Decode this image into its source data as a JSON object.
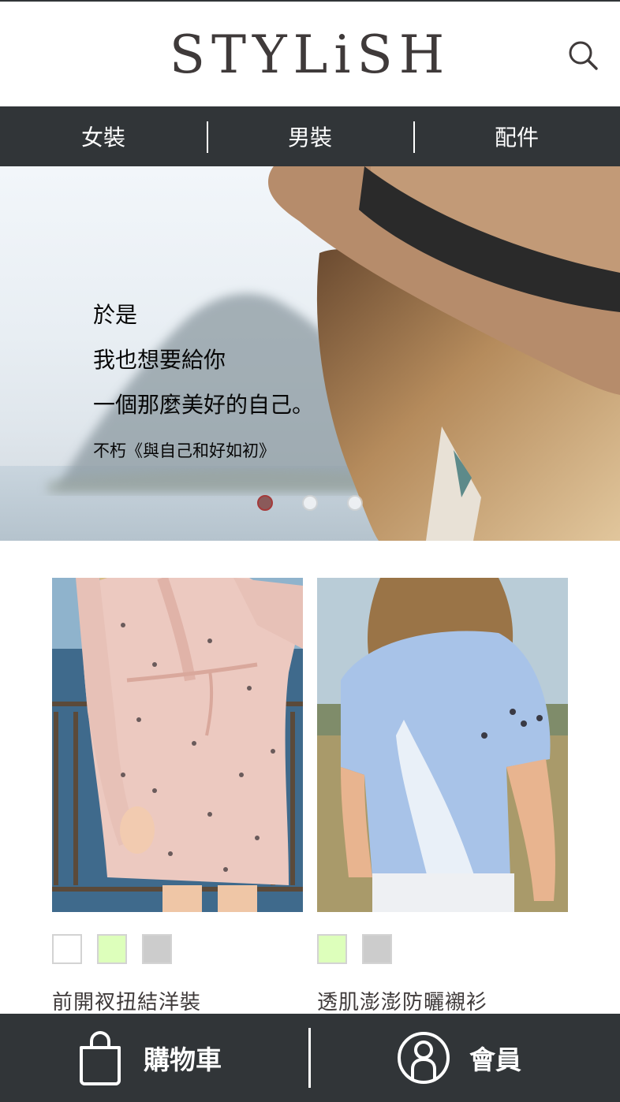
{
  "header": {
    "logo_text": "STYLiSH",
    "search_icon": "search-icon"
  },
  "categories": [
    {
      "label": "女裝"
    },
    {
      "label": "男裝"
    },
    {
      "label": "配件"
    }
  ],
  "hero": {
    "lines": [
      "於是",
      "我也想要給你",
      "一個那麼美好的自己。"
    ],
    "source": "不朽《與自己和好如初》",
    "slide_count": 3,
    "active_slide": 1
  },
  "products": [
    {
      "name": "前開衩扭結洋裝",
      "colors": [
        "#FFFFFF",
        "#DDFFBB",
        "#CCCCCC"
      ]
    },
    {
      "name": "透肌澎澎防曬襯衫",
      "colors": [
        "#DDFFBB",
        "#CCCCCC"
      ]
    }
  ],
  "bottom_nav": {
    "cart_label": "購物車",
    "cart_icon": "shopping-bag-icon",
    "member_label": "會員",
    "member_icon": "member-icon"
  },
  "colors": {
    "bar_background": "#313538",
    "text_primary": "#3F3A3A",
    "dot_active": "#8B5A5A"
  }
}
